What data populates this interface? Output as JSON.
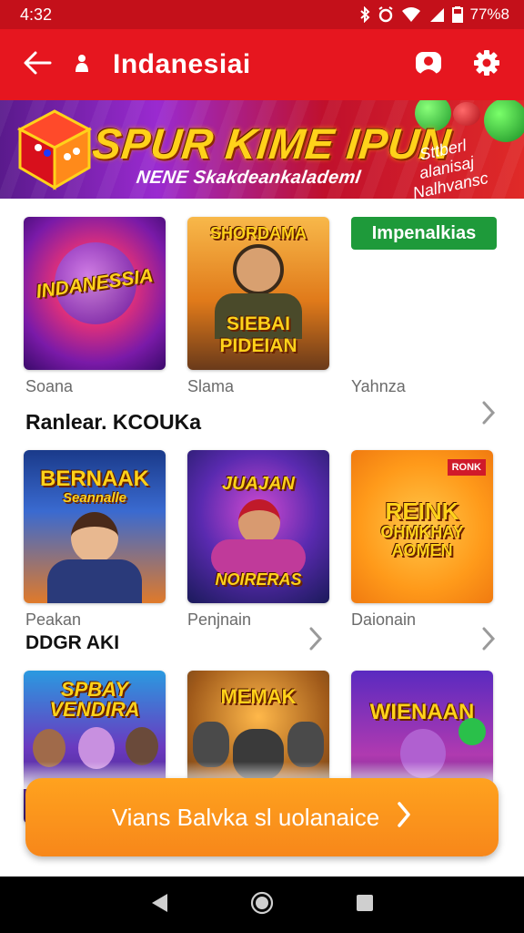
{
  "status_bar": {
    "time": "4:32",
    "battery": "77%8",
    "icons": [
      "bluetooth-icon",
      "alarm-icon",
      "wifi-icon",
      "signal-icon",
      "battery-icon"
    ]
  },
  "app_bar": {
    "title": "Indanesiai",
    "icons": [
      "back-arrow-icon",
      "person-icon",
      "profile-icon",
      "settings-gear-icon"
    ],
    "color": "#e6161f"
  },
  "banner": {
    "title": "SPUR KIME IPUN",
    "subtitle": "NENE Skakdeankalademl",
    "side_text": "Sttberl alanisaj Nalhvansc"
  },
  "sections": [
    {
      "title": "",
      "badge": "Impenalkias",
      "tiles": [
        {
          "label": "Soana",
          "art_text": "INDANESSIA"
        },
        {
          "label": "Slama",
          "art_text_top": "SHORDAMA",
          "art_text_bottom": "SIEBAI PIDEIAN"
        },
        {
          "label": "Yahnza"
        }
      ]
    },
    {
      "title": "Ranlear. KCOUKa",
      "tiles": [
        {
          "label": "Peakan",
          "art_text": "BERNAAK",
          "art_sub": "Seannalle"
        },
        {
          "label": "Penjnain",
          "art_text": "JUAJAN",
          "art_sub": "NOIRERAS"
        },
        {
          "label": "Daionain",
          "art_text": "REINK",
          "art_sub": "OHMKHAY AOMEN",
          "tag": "RONK"
        }
      ]
    },
    {
      "title": "DDGR AKI",
      "tiles": [
        {
          "art_text": "SPBAY VENDIRA"
        },
        {
          "art_text": "MEMAK"
        },
        {
          "art_text": "WIENAAN"
        }
      ]
    }
  ],
  "cta": {
    "label": "Vians Balvka sl uolanaice",
    "color": "#f7871a"
  },
  "nav_bar": {
    "icons": [
      "nav-back-icon",
      "nav-home-icon",
      "nav-recents-icon"
    ]
  }
}
